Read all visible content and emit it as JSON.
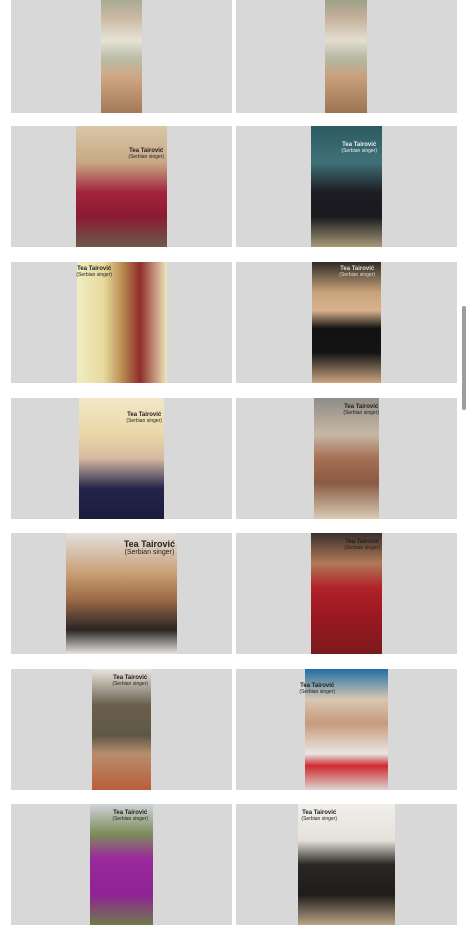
{
  "gallery": {
    "caption_name": "Tea Tairović",
    "caption_sub": "(Serbian singer)",
    "tiles": [
      {
        "id": "1"
      },
      {
        "id": "2"
      },
      {
        "id": "3"
      },
      {
        "id": "4"
      },
      {
        "id": "5"
      },
      {
        "id": "6"
      },
      {
        "id": "7"
      },
      {
        "id": "8"
      },
      {
        "id": "9"
      },
      {
        "id": "10"
      },
      {
        "id": "11"
      },
      {
        "id": "12"
      },
      {
        "id": "13"
      },
      {
        "id": "14"
      }
    ]
  },
  "colors": {
    "tile_bg": "#d8d8d8",
    "page_bg": "#ffffff",
    "scrollbar": "#9e9e9e"
  }
}
